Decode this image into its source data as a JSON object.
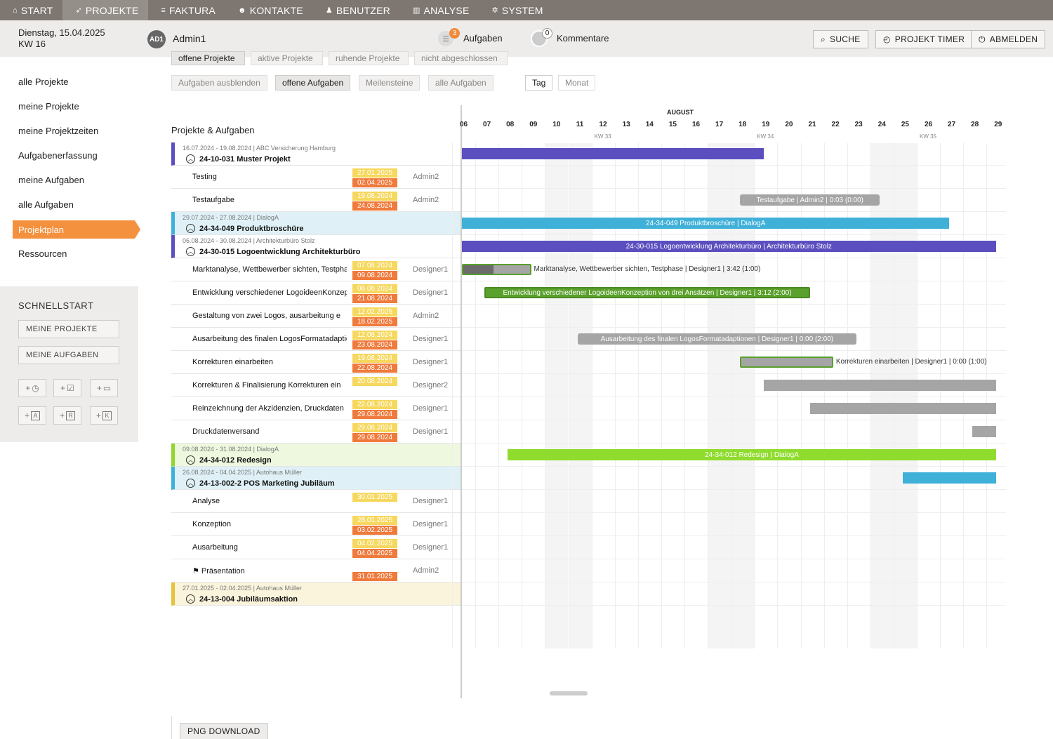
{
  "nav": [
    {
      "label": "START",
      "icon": "home-icon",
      "glyph": "⌂"
    },
    {
      "label": "PROJEKTE",
      "icon": "rocket-icon",
      "glyph": "➶",
      "active": true
    },
    {
      "label": "FAKTURA",
      "icon": "invoice-icon",
      "glyph": "≡"
    },
    {
      "label": "KONTAKTE",
      "icon": "contacts-icon",
      "glyph": "☻"
    },
    {
      "label": "BENUTZER",
      "icon": "user-icon",
      "glyph": "♟"
    },
    {
      "label": "ANALYSE",
      "icon": "chart-icon",
      "glyph": "▥"
    },
    {
      "label": "SYSTEM",
      "icon": "gear-icon",
      "glyph": "✲"
    }
  ],
  "header": {
    "date": "Dienstag, 15.04.2025",
    "week": "KW 16",
    "avatar": "AD1",
    "username": "Admin1",
    "tasks_count": "3",
    "tasks_label": "Aufgaben",
    "comments_count": "0",
    "comments_label": "Kommentare",
    "search": "SUCHE",
    "timer": "PROJEKT TIMER",
    "logout": "ABMELDEN"
  },
  "menu": [
    "alle Projekte",
    "meine Projekte",
    "meine Projektzeiten",
    "Aufgabenerfassung",
    "meine Aufgaben",
    "alle Aufgaben",
    "Projektplan",
    "Ressourcen"
  ],
  "menu_active": 6,
  "quick": {
    "title": "SCHNELLSTART",
    "btn1": "MEINE PROJEKTE",
    "btn2": "MEINE AUFGABEN",
    "icons": [
      {
        "name": "add-time-icon",
        "sym": "◷"
      },
      {
        "name": "add-task-icon",
        "sym": "☑"
      },
      {
        "name": "add-folder-icon",
        "sym": "▭"
      },
      {
        "name": "add-a-icon",
        "sym": "A"
      },
      {
        "name": "add-r-icon",
        "sym": "R"
      },
      {
        "name": "add-k-icon",
        "sym": "K"
      }
    ]
  },
  "filters_top": [
    "offene Projekte",
    "aktive Projekte",
    "ruhende Projekte",
    "nicht abgeschlossen"
  ],
  "filters": [
    "Aufgaben ausblenden",
    "offene Aufgaben",
    "Meilensteine",
    "alle Aufgaben"
  ],
  "filters_active": 1,
  "view": [
    "Tag",
    "Monat"
  ],
  "list_title": "Projekte & Aufgaben",
  "rows": [
    {
      "type": "proj",
      "color": "#5b4fc0",
      "bg": "#fff",
      "meta": "16.07.2024 - 19.08.2024 | ABC Versicherung Hamburg",
      "title": "24-10-031 Muster Projekt"
    },
    {
      "type": "task",
      "name": "Testing",
      "d1": "27.01.2025",
      "d2": "02.04.2025",
      "who": "Admin2"
    },
    {
      "type": "task",
      "name": "Testaufgabe",
      "d1": "19.08.2024",
      "d2": "24.08.2024",
      "who": "Admin2"
    },
    {
      "type": "proj",
      "color": "#3fb0d8",
      "bg": "#dff1f7",
      "meta": "29.07.2024 - 27.08.2024 | DialogA",
      "title": "24-34-049 Produktbroschüre"
    },
    {
      "type": "proj",
      "color": "#5b4fc0",
      "bg": "#fff",
      "meta": "06.08.2024 - 30.08.2024 | Architekturbüro Stolz",
      "title": "24-30-015 Logoentwicklung Architekturbüro"
    },
    {
      "type": "task",
      "name": "Marktanalyse, Wettbewerber sichten, Testphase",
      "d1": "07.08.2024",
      "d2": "09.08.2024",
      "who": "Designer1"
    },
    {
      "type": "task",
      "name": "Entwicklung verschiedener LogoideenKonzeption",
      "d1": "08.08.2024",
      "d2": "21.08.2024",
      "who": "Designer1"
    },
    {
      "type": "task",
      "name": "Gestaltung von zwei Logos, ausarbeitung e",
      "d1": "12.02.2025",
      "d2": "18.02.2025",
      "who": "Admin2"
    },
    {
      "type": "task",
      "name": "Ausarbeitung des finalen LogosFormatadaptionen",
      "d1": "12.08.2024",
      "d2": "23.08.2024",
      "who": "Designer1"
    },
    {
      "type": "task",
      "name": "Korrekturen einarbeiten",
      "d1": "19.08.2024",
      "d2": "22.08.2024",
      "who": "Designer1"
    },
    {
      "type": "task",
      "name": "Korrekturen & Finalisierung Korrekturen ein",
      "d1": "20.08.2024",
      "d2": "",
      "who": "Designer2"
    },
    {
      "type": "task",
      "name": "Reinzeichnung der Akzidenzien, Druckdaten",
      "d1": "22.08.2024",
      "d2": "29.08.2024",
      "who": "Designer1"
    },
    {
      "type": "task",
      "name": "Druckdatenversand",
      "d1": "29.08.2024",
      "d2": "29.08.2024",
      "who": "Designer1"
    },
    {
      "type": "proj",
      "color": "#8fd62e",
      "bg": "#eef8df",
      "meta": "09.08.2024 - 31.08.2024 | DialogA",
      "title": "24-34-012 Redesign"
    },
    {
      "type": "proj",
      "color": "#3fb0d8",
      "bg": "#dff1f7",
      "meta": "26.08.2024 - 04.04.2025 | Autohaus Müller",
      "title": "24-13-002-2 POS Marketing Jubiläum"
    },
    {
      "type": "task",
      "name": "Analyse",
      "d1": "30.01.2025",
      "d2": "",
      "who": "Designer1"
    },
    {
      "type": "task",
      "name": "Konzeption",
      "d1": "28.01.2025",
      "d2": "03.02.2025",
      "who": "Designer1"
    },
    {
      "type": "task",
      "name": "Ausarbeitung",
      "d1": "04.02.2025",
      "d2": "04.04.2025",
      "who": "Designer1"
    },
    {
      "type": "milestone",
      "name": "Präsentation",
      "d1": "",
      "d2": "31.01.2025",
      "who": "Admin2"
    },
    {
      "type": "proj",
      "color": "#e6c33a",
      "bg": "#faf4dc",
      "meta": "27.01.2025 - 02.04.2025 | Autohaus Müller",
      "title": "24-13-004 Jubiläumsaktion"
    }
  ],
  "gantt": {
    "month": "AUGUST",
    "days": [
      "06",
      "07",
      "08",
      "09",
      "10",
      "11",
      "12",
      "13",
      "14",
      "15",
      "16",
      "17",
      "18",
      "19",
      "20",
      "21",
      "22",
      "23",
      "24",
      "25",
      "26",
      "27",
      "28",
      "29"
    ],
    "weekend_idx": [
      4,
      5,
      11,
      12,
      18,
      19
    ],
    "kw": [
      {
        "idx": 6,
        "label": "KW 33"
      },
      {
        "idx": 13,
        "label": "KW 34"
      },
      {
        "idx": 20,
        "label": "KW 35"
      }
    ],
    "bars": [
      {
        "row": 0,
        "start": 0,
        "end": 13.4,
        "color": "#5b4fc0",
        "text": ""
      },
      {
        "row": 2,
        "start": 12.4,
        "end": 18.4,
        "color": "#a5a5a5",
        "text": "Testaufgabe | Admin2 | 0:03 (0:00)",
        "round": true
      },
      {
        "row": 3,
        "start": 0,
        "end": 21.4,
        "color": "#3fb0d8",
        "text": "24-34-049 Produktbroschüre | DialogA"
      },
      {
        "row": 4,
        "start": 0,
        "end": 23.4,
        "color": "#5b4fc0",
        "text": "24-30-015 Logoentwicklung Architekturbüro | Architekturbüro Stolz"
      },
      {
        "row": 5,
        "start": 0.4,
        "end": 3.4,
        "color": "#a5a5a5",
        "text": "",
        "outline": "#5aa02c",
        "progress": 0.45,
        "after": "Marktanalyse, Wettbewerber sichten, Testphase | Designer1 | 3:42 (1:00)"
      },
      {
        "row": 6,
        "start": 1.4,
        "end": 15.4,
        "color": "#5aa02c",
        "text": "Entwicklung verschiedener LogoideenKonzeption von drei Ansätzen | Designer1 | 3:12 (2:00)",
        "outline": "#4a8a24"
      },
      {
        "row": 8,
        "start": 5.4,
        "end": 17.4,
        "color": "#a5a5a5",
        "text": "Ausarbeitung des finalen LogosFormatadaptionen | Designer1 | 0:00 (2:00)",
        "round": true
      },
      {
        "row": 9,
        "start": 12.4,
        "end": 16.4,
        "color": "#a5a5a5",
        "text": "",
        "outline": "#5aa02c",
        "after": "Korrekturen einarbeiten | Designer1 | 0:00 (1:00)"
      },
      {
        "row": 10,
        "start": 13.4,
        "end": 23.4,
        "color": "#a5a5a5",
        "text": ""
      },
      {
        "row": 11,
        "start": 15.4,
        "end": 23.4,
        "color": "#a5a5a5",
        "text": ""
      },
      {
        "row": 12,
        "start": 22.4,
        "end": 23.4,
        "color": "#a5a5a5",
        "text": ""
      },
      {
        "row": 13,
        "start": 2.4,
        "end": 23.4,
        "color": "#8fdc2e",
        "text": "24-34-012 Redesign | DialogA"
      },
      {
        "row": 14,
        "start": 19.4,
        "end": 23.4,
        "color": "#3fb0d8",
        "text": ""
      }
    ]
  },
  "png": "PNG DOWNLOAD"
}
